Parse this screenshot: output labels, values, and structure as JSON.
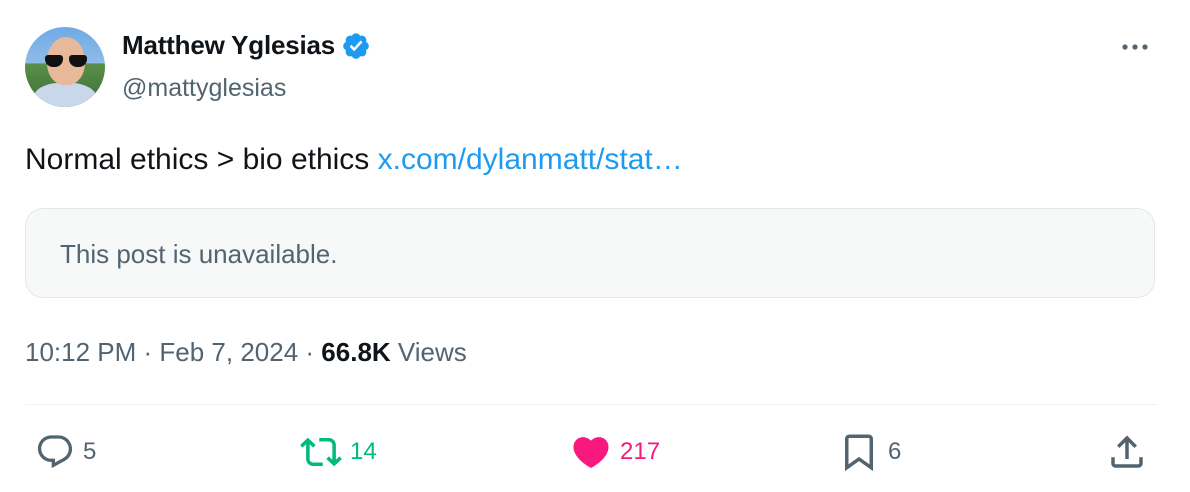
{
  "author": {
    "display_name": "Matthew Yglesias",
    "handle": "@mattyglesias",
    "verified": true
  },
  "post": {
    "text": "Normal ethics > bio ethics ",
    "link_text": "x.com/dylanmatt/stat…"
  },
  "quoted_post": {
    "message": "This post is unavailable."
  },
  "meta": {
    "time": "10:12 PM",
    "separator1": " · ",
    "date": "Feb 7, 2024",
    "separator2": " · ",
    "views_count": "66.8K",
    "views_label": " Views"
  },
  "actions": {
    "replies": "5",
    "reposts": "14",
    "likes": "217",
    "bookmarks": "6"
  },
  "colors": {
    "accent": "#1d9bf0",
    "repost": "#00ba7c",
    "like": "#f91880",
    "muted": "#536471"
  },
  "icons": {
    "verified": "verified-badge-icon",
    "more": "more-options-icon",
    "reply": "reply-icon",
    "repost": "repost-icon",
    "like": "heart-icon",
    "bookmark": "bookmark-icon",
    "share": "share-icon"
  }
}
